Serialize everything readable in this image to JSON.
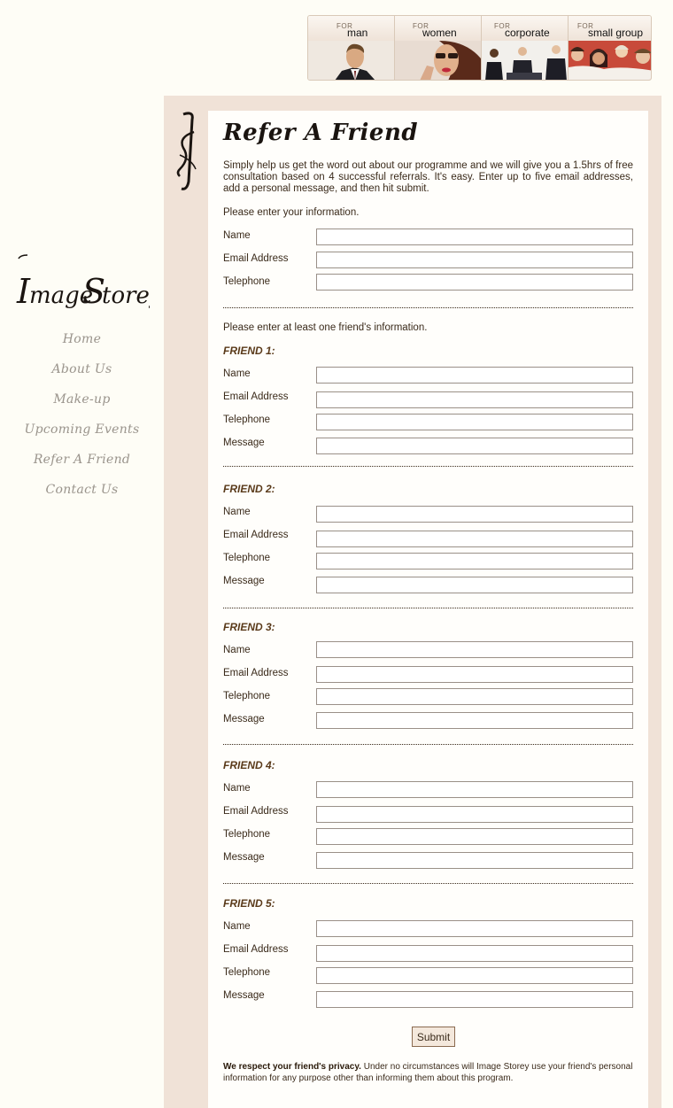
{
  "tabs": [
    {
      "for": "FOR",
      "label": "man"
    },
    {
      "for": "FOR",
      "label": "women"
    },
    {
      "for": "FOR",
      "label": "corporate"
    },
    {
      "for": "FOR",
      "label": "small group"
    }
  ],
  "brand": {
    "logo_text": "Image Storey"
  },
  "nav": {
    "items": [
      "Home",
      "About Us",
      "Make-up",
      "Upcoming Events",
      "Refer A Friend",
      "Contact Us"
    ]
  },
  "page": {
    "title": "Refer A Friend",
    "intro": "Simply help us get the word out about our programme and we will give you a 1.5hrs of free consultation based on 4 successful referrals. It's easy. Enter up to five email addresses, add a personal message, and then hit submit.",
    "your_info_prompt": "Please enter your information.",
    "friend_info_prompt": "Please enter at least one friend's information."
  },
  "labels": {
    "name": "Name",
    "email": "Email Address",
    "telephone": "Telephone",
    "message": "Message"
  },
  "friends": [
    "FRIEND 1:",
    "FRIEND 2:",
    "FRIEND 3:",
    "FRIEND 4:",
    "FRIEND 5:"
  ],
  "form": {
    "your_name": "",
    "your_email": "",
    "your_telephone": "",
    "submit_label": "Submit"
  },
  "privacy": {
    "bold": "We respect your friend's privacy.",
    "text": " Under no circumstances will Image Storey use your friend's personal information for any purpose other than informing them about this program."
  },
  "colors": {
    "page_bg": "#fefdf6",
    "panel_bg": "#f0e2d7",
    "nav_text": "#9a948c",
    "heading_brown": "#5a3a1a"
  }
}
